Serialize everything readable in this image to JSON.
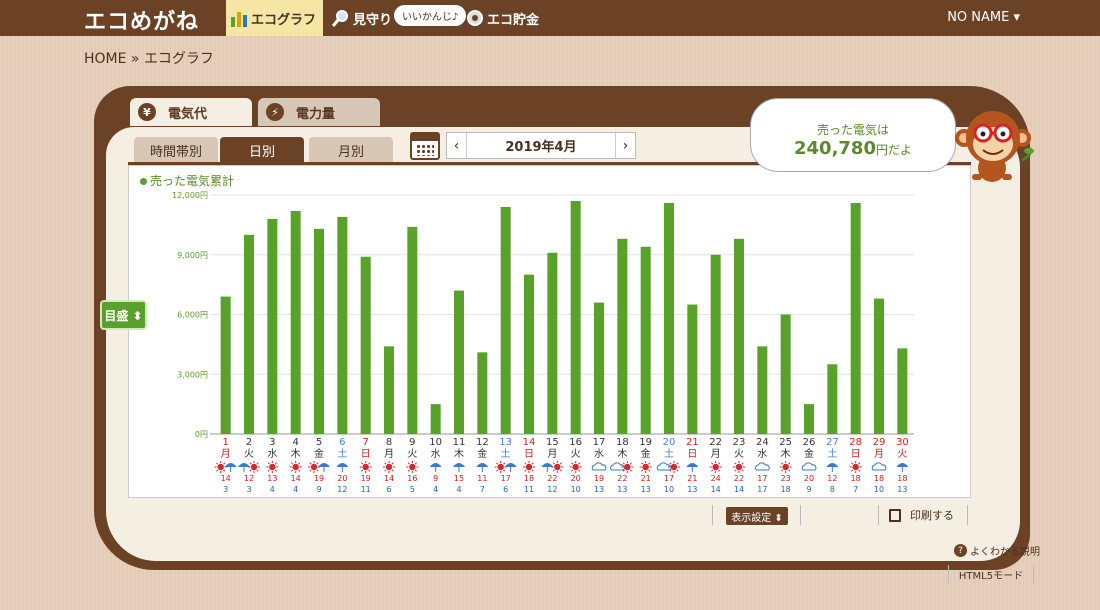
{
  "header": {
    "logo": "エコめがね",
    "nav": [
      {
        "label": "エコグラフ",
        "icon": "bar-chart-icon",
        "active": true
      },
      {
        "label": "見守り",
        "icon": "magnifier-icon",
        "active": false
      },
      {
        "label": "エコ貯金",
        "icon": "coin-icon",
        "active": false
      }
    ],
    "bubble": "いいかんじ♪",
    "user": "NO NAME ▾"
  },
  "breadcrumb": "HOME » エコグラフ",
  "tabs_top": [
    {
      "label": "電気代",
      "icon": "¥"
    },
    {
      "label": "電力量",
      "icon": "⚡"
    }
  ],
  "tabs_sub": [
    "時間帯別",
    "日別",
    "月別"
  ],
  "date_nav": {
    "prev": "‹",
    "label": "2019年4月",
    "next": "›"
  },
  "scale_button": "目盛 ⬍",
  "speech": {
    "line1": "売った電気は",
    "amount": "240,780",
    "suffix": "円だよ"
  },
  "buttons": {
    "display": "表示設定 ⬍",
    "print": "印刷する",
    "help": "よくわかる説明",
    "html5": "HTML5モード"
  },
  "colors": {
    "bar": "#58a22a",
    "brown": "#6b4226",
    "holiday": "#cc2222",
    "saturday": "#4a80d0",
    "weekday": "#333333"
  },
  "chart_data": {
    "type": "bar",
    "title": "",
    "legend": "売った電気累計",
    "ylim": [
      0,
      12000
    ],
    "yticks": [
      "0円",
      "3,000円",
      "6,000円",
      "9,000円",
      "12,000円"
    ],
    "categories": [
      "1",
      "2",
      "3",
      "4",
      "5",
      "6",
      "7",
      "8",
      "9",
      "10",
      "11",
      "12",
      "13",
      "14",
      "15",
      "16",
      "17",
      "18",
      "19",
      "20",
      "21",
      "22",
      "23",
      "24",
      "25",
      "26",
      "27",
      "28",
      "29",
      "30"
    ],
    "weekdays": [
      "月",
      "火",
      "水",
      "木",
      "金",
      "土",
      "日",
      "月",
      "火",
      "水",
      "木",
      "金",
      "土",
      "日",
      "月",
      "火",
      "水",
      "木",
      "金",
      "土",
      "日",
      "月",
      "火",
      "水",
      "木",
      "金",
      "土",
      "日",
      "月",
      "火"
    ],
    "day_types": [
      "h",
      "w",
      "w",
      "w",
      "w",
      "s",
      "h",
      "w",
      "w",
      "w",
      "w",
      "w",
      "s",
      "h",
      "w",
      "w",
      "w",
      "w",
      "w",
      "s",
      "h",
      "w",
      "w",
      "w",
      "w",
      "w",
      "s",
      "h",
      "h",
      "h"
    ],
    "values": [
      6900,
      10000,
      10800,
      11200,
      10300,
      10900,
      8900,
      4400,
      10400,
      1500,
      7200,
      4100,
      11400,
      8000,
      9100,
      11700,
      6600,
      9800,
      9400,
      11600,
      6500,
      9000,
      9800,
      4400,
      6000,
      1500,
      3500,
      11600,
      6800,
      4300
    ],
    "weather": [
      "sun-rain",
      "rain-sun",
      "sun",
      "sun",
      "sun-rain",
      "rain",
      "sun",
      "sun",
      "sun",
      "rain",
      "rain",
      "rain",
      "sun-rain",
      "sun",
      "rain-sun",
      "sun",
      "cloud",
      "cloud-sun",
      "sun",
      "cloud-sun",
      "rain",
      "sun",
      "sun",
      "cloud",
      "sun",
      "cloud",
      "rain",
      "sun",
      "cloud",
      "rain"
    ],
    "temp_high": [
      "14",
      "12",
      "13",
      "14",
      "19",
      "20",
      "19",
      "14",
      "16",
      "9",
      "15",
      "11",
      "17",
      "18",
      "22",
      "20",
      "19",
      "22",
      "21",
      "17",
      "21",
      "24",
      "22",
      "17",
      "23",
      "20",
      "12",
      "18",
      "18",
      "18"
    ],
    "temp_low": [
      "3",
      "3",
      "4",
      "4",
      "9",
      "12",
      "11",
      "6",
      "5",
      "4",
      "4",
      "7",
      "6",
      "11",
      "12",
      "10",
      "13",
      "13",
      "13",
      "10",
      "13",
      "14",
      "14",
      "17",
      "18",
      "9",
      "8",
      "7",
      "10",
      "13"
    ]
  }
}
